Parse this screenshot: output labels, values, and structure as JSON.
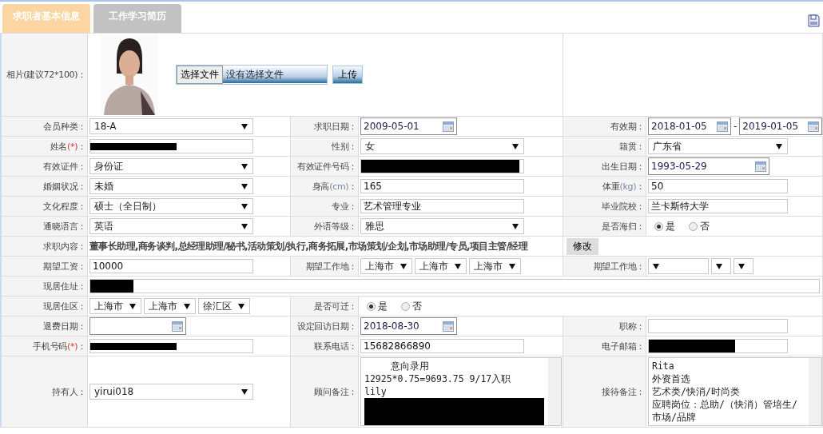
{
  "tabs": [
    {
      "label": "求职者基本信息",
      "selected": true
    },
    {
      "label": "工作学习简历",
      "selected": false
    }
  ],
  "photo_row": {
    "label": "相片(建议72*100)：",
    "choose_button": "选择文件",
    "file_status": "没有选择文件",
    "upload_button": "上传"
  },
  "rows": [
    {
      "cells": [
        {
          "label": "会员种类：",
          "kind": "select",
          "value": "18-A"
        },
        {
          "label": "求职日期：",
          "kind": "date",
          "value": "2009-05-01"
        },
        {
          "label": "有效期：",
          "kind": "date-range",
          "from": "2018-01-05",
          "separator": "-",
          "to": "2019-01-05"
        }
      ]
    },
    {
      "cells": [
        {
          "label": "姓名",
          "required_mark": "(*)",
          "colon": "：",
          "kind": "redacted"
        },
        {
          "label": "性别：",
          "kind": "select",
          "value": "女"
        },
        {
          "label": "籍贯：",
          "kind": "select",
          "value": "广东省"
        }
      ]
    },
    {
      "cells": [
        {
          "label": "有效证件：",
          "kind": "select",
          "value": "身份证"
        },
        {
          "label": "有效证件号码：",
          "kind": "redacted"
        },
        {
          "label": "出生日期：",
          "kind": "date",
          "value": "1993-05-29"
        }
      ]
    },
    {
      "cells": [
        {
          "label": "婚姻状况：",
          "kind": "select",
          "value": "未婚"
        },
        {
          "label": "身高",
          "unit": "(cm)",
          "colon": "：",
          "kind": "text",
          "value": "165"
        },
        {
          "label": "体重",
          "unit": "(kg)",
          "colon": "：",
          "kind": "text",
          "value": "50"
        }
      ]
    },
    {
      "cells": [
        {
          "label": "文化程度：",
          "kind": "select",
          "value": "硕士（全日制）"
        },
        {
          "label": "专业：",
          "kind": "text",
          "value": "艺术管理专业"
        },
        {
          "label": "毕业院校：",
          "kind": "text",
          "value": "兰卡斯特大学"
        }
      ]
    },
    {
      "cells": [
        {
          "label": "通晓语言：",
          "kind": "select",
          "value": "英语"
        },
        {
          "label": "外语等级：",
          "kind": "select",
          "value": "雅思"
        },
        {
          "label": "是否海归：",
          "kind": "radio",
          "options": [
            {
              "label": "是",
              "selected": true
            },
            {
              "label": "否",
              "selected": false
            }
          ]
        }
      ]
    },
    {
      "cells": [
        {
          "label": "求职内容：",
          "kind": "tags",
          "value": "董事长助理,商务谈判,总经理助理/秘书,活动策划/执行,商务拓展,市场策划/企划,市场助理/专员,项目主管/经理",
          "button": "修改"
        }
      ]
    },
    {
      "cells": [
        {
          "label": "期望工资：",
          "kind": "text",
          "value": "10000"
        },
        {
          "label": "期望工作地：",
          "kind": "selects",
          "values": [
            "上海市",
            "上海市",
            "上海市"
          ]
        },
        {
          "label": "期望工作地：",
          "kind": "blank-selects"
        }
      ]
    },
    {
      "cells": [
        {
          "label": "现居住址：",
          "kind": "redacted-wide"
        }
      ]
    },
    {
      "cells": [
        {
          "label": "现居住区：",
          "kind": "selects",
          "values": [
            "上海市",
            "上海市",
            "徐汇区"
          ]
        },
        {
          "label": "是否可迁：",
          "kind": "radio-wide",
          "options": [
            {
              "label": "是",
              "selected": true
            },
            {
              "label": "否",
              "selected": false
            }
          ]
        }
      ]
    },
    {
      "cells": [
        {
          "label": "退费日期：",
          "kind": "date"
        },
        {
          "label": "设定回访日期：",
          "kind": "date",
          "value": "2018-08-30"
        },
        {
          "label": "职称：",
          "kind": "text"
        }
      ]
    },
    {
      "cells": [
        {
          "label": "手机号码",
          "required_mark": "(*)",
          "colon": "：",
          "kind": "redacted"
        },
        {
          "label": "联系电话：",
          "kind": "text",
          "value": "15682866890"
        },
        {
          "label": "电子邮箱：",
          "kind": "redacted"
        }
      ]
    },
    {
      "cells": [
        {
          "label": "持有人：",
          "kind": "select",
          "value": "yirui018"
        },
        {
          "label": "顾问备注：",
          "kind": "textarea",
          "lines": [
            {
              "kind": "redacted-prefixed",
              "text": "意向录用"
            },
            {
              "kind": "text",
              "text": "12925*0.75=9693.75  9/17入职"
            },
            {
              "kind": "text",
              "text": "lily"
            },
            {
              "kind": "redacted"
            },
            {
              "kind": "redacted"
            }
          ]
        },
        {
          "label": "接待备注：",
          "kind": "textarea",
          "lines": [
            {
              "kind": "text",
              "text": "Rita"
            },
            {
              "kind": "text",
              "text": "外资首选"
            },
            {
              "kind": "text",
              "text": "艺术类/快消/时尚类"
            },
            {
              "kind": "text",
              "text": "应聘岗位：总助/（快消）管培生/市场/品牌"
            }
          ]
        }
      ]
    }
  ]
}
